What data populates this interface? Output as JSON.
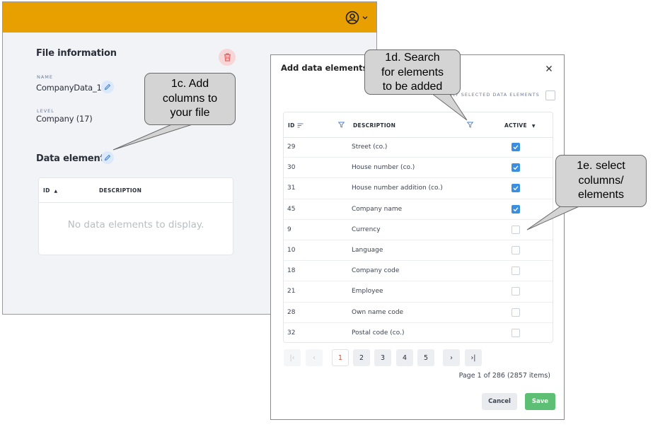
{
  "app": {
    "file_info_title": "File information",
    "name_label": "NAME",
    "name_value": "CompanyData_17",
    "level_label": "LEVEL",
    "level_value": "Company (17)",
    "data_elements_title": "Data elements",
    "table": {
      "col_id": "ID",
      "col_description": "DESCRIPTION",
      "empty_message": "No data elements to display."
    }
  },
  "modal": {
    "title": "Add data elements",
    "only_selected_label": "ONLY SELECTED DATA ELEMENTS",
    "columns": {
      "id": "ID",
      "description": "DESCRIPTION",
      "active": "ACTIVE"
    },
    "rows": [
      {
        "id": "29",
        "description": "Street (co.)",
        "active": true
      },
      {
        "id": "30",
        "description": "House number (co.)",
        "active": true
      },
      {
        "id": "31",
        "description": "House number addition (co.)",
        "active": true
      },
      {
        "id": "45",
        "description": "Company name",
        "active": true
      },
      {
        "id": "9",
        "description": "Currency",
        "active": false
      },
      {
        "id": "10",
        "description": "Language",
        "active": false
      },
      {
        "id": "18",
        "description": "Company code",
        "active": false
      },
      {
        "id": "21",
        "description": "Employee",
        "active": false
      },
      {
        "id": "28",
        "description": "Own name code",
        "active": false
      },
      {
        "id": "32",
        "description": "Postal code (co.)",
        "active": false
      }
    ],
    "pagination": {
      "first": "|‹",
      "prev": "‹",
      "pages": [
        "1",
        "2",
        "3",
        "4",
        "5"
      ],
      "current_page": "1",
      "next": "›",
      "last": "›|",
      "info": "Page 1 of 286 (2857 items)"
    },
    "cancel_label": "Cancel",
    "save_label": "Save"
  },
  "callouts": {
    "c1": [
      "1c. Add",
      "columns to",
      "your file"
    ],
    "c2": [
      "1d. Search",
      "for elements",
      "to be added"
    ],
    "c3": [
      "1e. select",
      "columns/",
      "elements"
    ]
  },
  "colors": {
    "topbar": "#e8a000",
    "checkbox_on": "#3b8fe0",
    "save": "#5cbf73",
    "delete_bg": "#f6d6d6",
    "current_page": "#d05030"
  },
  "icons": [
    "user-circle-icon",
    "chevron-down-icon",
    "trash-icon",
    "pencil-icon",
    "sort-asc-icon",
    "sort-lines-icon",
    "filter-icon",
    "caret-down-icon",
    "close-icon",
    "check-icon"
  ]
}
